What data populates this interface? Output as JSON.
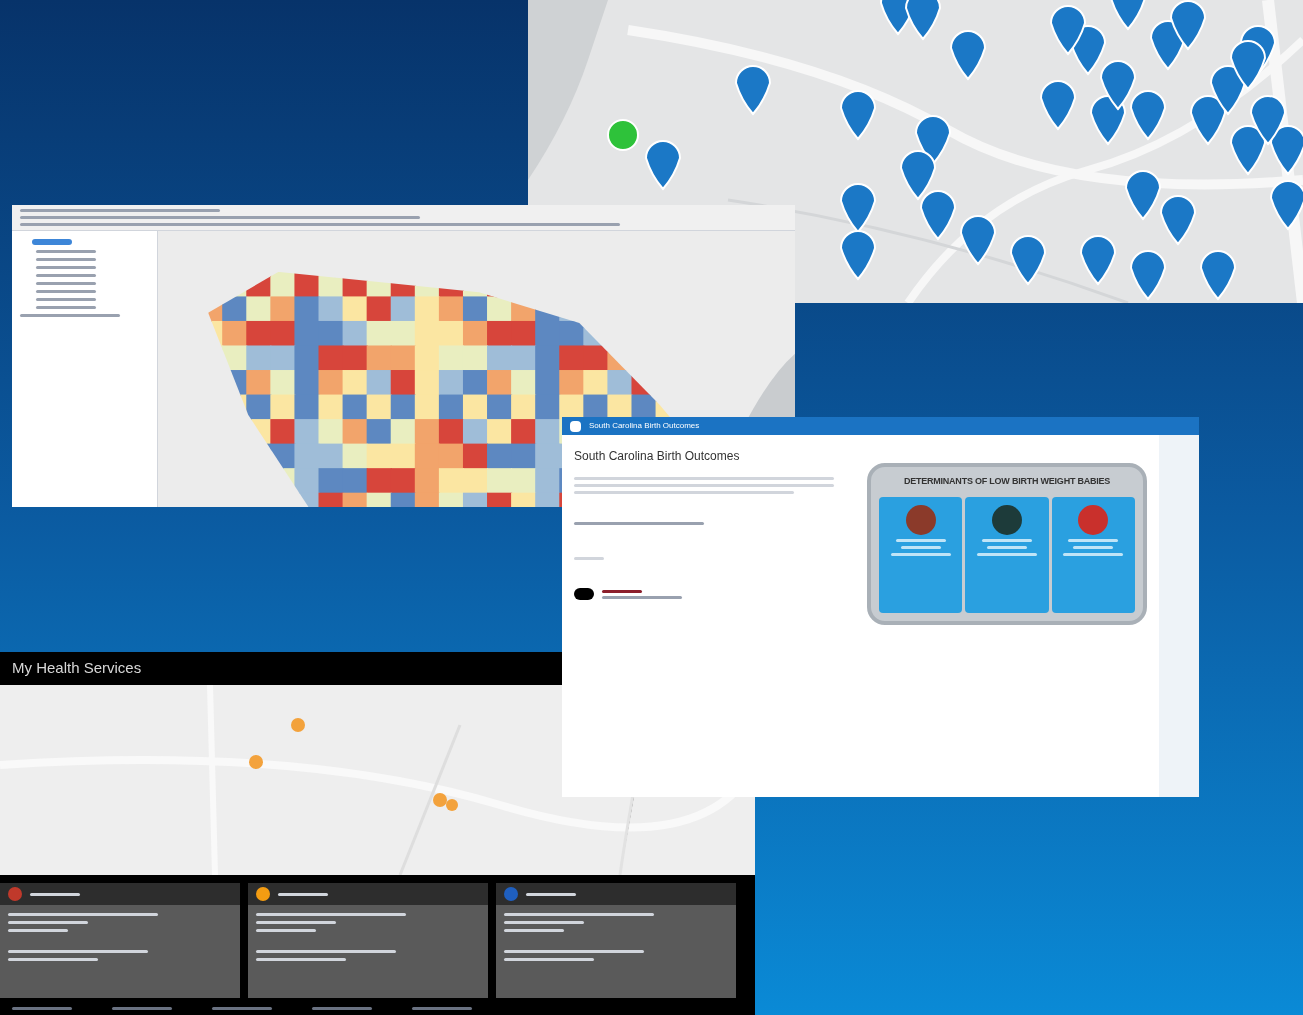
{
  "birth_window": {
    "title": "South Carolina Birth Outcomes",
    "heading": "South Carolina Birth Outcomes",
    "infographic_title": "DETERMINANTS OF LOW BIRTH WEIGHT BABIES"
  },
  "health_window": {
    "title": "My Health Services",
    "cards": [
      {
        "color": "#c0392b"
      },
      {
        "color": "#f39c12"
      },
      {
        "color": "#1f5fbf"
      }
    ]
  }
}
